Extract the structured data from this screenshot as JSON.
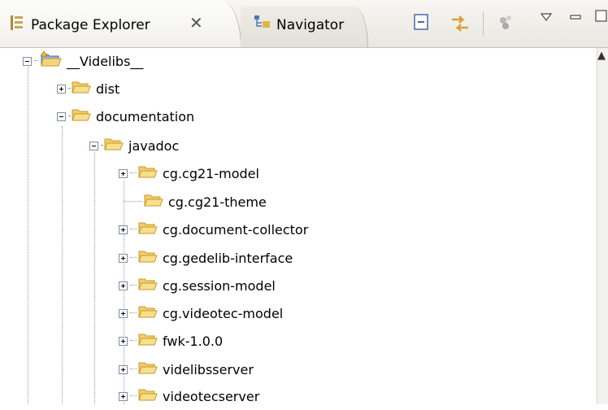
{
  "tabs": [
    {
      "label": "Package Explorer",
      "active": true
    },
    {
      "label": "Navigator",
      "active": false
    }
  ],
  "toolbar": {
    "collapse_all": "collapse-all-icon",
    "link_with_editor": "link-with-editor-icon",
    "focus": "focus-active-task-icon",
    "view_menu": "view-menu-icon",
    "minimize": "minimize-icon",
    "maximize": "maximize-icon"
  },
  "tree": {
    "root": {
      "label": "__Videlibs__",
      "expanded": true
    },
    "dist": {
      "label": "dist",
      "expanded": false
    },
    "documentation": {
      "label": "documentation",
      "expanded": true
    },
    "javadoc": {
      "label": "javadoc",
      "expanded": true
    },
    "children": [
      {
        "label": "cg.cg21-model",
        "expandable": true
      },
      {
        "label": "cg.cg21-theme",
        "expandable": false
      },
      {
        "label": "cg.document-collector",
        "expandable": true
      },
      {
        "label": "cg.gedelib-interface",
        "expandable": true
      },
      {
        "label": "cg.session-model",
        "expandable": true
      },
      {
        "label": "cg.videotec-model",
        "expandable": true
      },
      {
        "label": "fwk-1.0.0",
        "expandable": true
      },
      {
        "label": "videlibsserver",
        "expandable": true
      },
      {
        "label": "videotecserver",
        "expandable": true
      }
    ]
  },
  "colors": {
    "folder_fill": "#f6d57a",
    "folder_stroke": "#c79a2a",
    "project_fill": "#8fb4e6"
  }
}
